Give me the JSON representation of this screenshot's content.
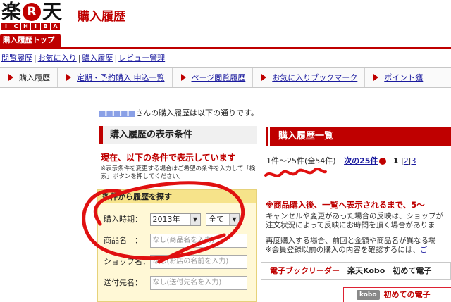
{
  "header": {
    "logo_chars": [
      "楽",
      "天"
    ],
    "logo_mark": "R",
    "logo_sub": [
      "I",
      "C",
      "H",
      "I",
      "B",
      "A"
    ],
    "title": "購入履歴"
  },
  "top_tab": "購入履歴トップ",
  "sublinks": [
    "閲覧履歴",
    "お気に入り",
    "購入履歴",
    "レビュー管理"
  ],
  "nav": [
    {
      "label": "購入履歴",
      "current": true
    },
    {
      "label": "定期・予約購入 申込一覧",
      "current": false
    },
    {
      "label": "ページ閲覧履歴",
      "current": false
    },
    {
      "label": "お気に入りブックマーク",
      "current": false
    },
    {
      "label": "ポイント獲",
      "current": false
    }
  ],
  "intro": {
    "user": "■■■■■",
    "text": "さんの購入履歴は以下の通りです。"
  },
  "left": {
    "heading": "購入履歴の表示条件",
    "cond_title": "現在、以下の条件で表示しています",
    "cond_note": "※表示条件を変更する場合はご希望の条件を入力して「検索」ボタンを押してください。",
    "search_title": "条件から履歴を探す",
    "year_label": "購入時期：",
    "year_value": "2013年",
    "month_value": "全て",
    "product_label": "商品名　：",
    "product_placeholder": "なし(商品名を入力)",
    "shop_label": "ショップ名：",
    "shop_placeholder": "なし(お店の名前を入力)",
    "dest_label": "送付先名：",
    "dest_placeholder": "なし(送付先名を入力)"
  },
  "right": {
    "heading": "購入履歴一覧",
    "range": "1件～25件(全54件)",
    "next": "次の25件",
    "pages": [
      "1",
      "2",
      "3"
    ],
    "note_head": "※商品購入後、一覧へ表示されるまで、5～",
    "note1": "キャンセルや変更があった場合の反映は、ショップが",
    "note2": "注文状況によって反映にお時間を頂く場合がありま",
    "note3": "再度購入する場合、前回と金額や商品名が異なる場",
    "note4": "※会員登録以前の購入の内容を確認するには、",
    "note4_link": "ご",
    "ebook_red": "電子ブックリーダー",
    "ebook_rest": "楽天Kobo　初めて電子",
    "kobo_badge": "kobo",
    "kobo_text": "初めての電子"
  },
  "colors": {
    "brand": "#bf0000",
    "link": "#1a1a9e",
    "search_bg": "#fff8d6"
  }
}
